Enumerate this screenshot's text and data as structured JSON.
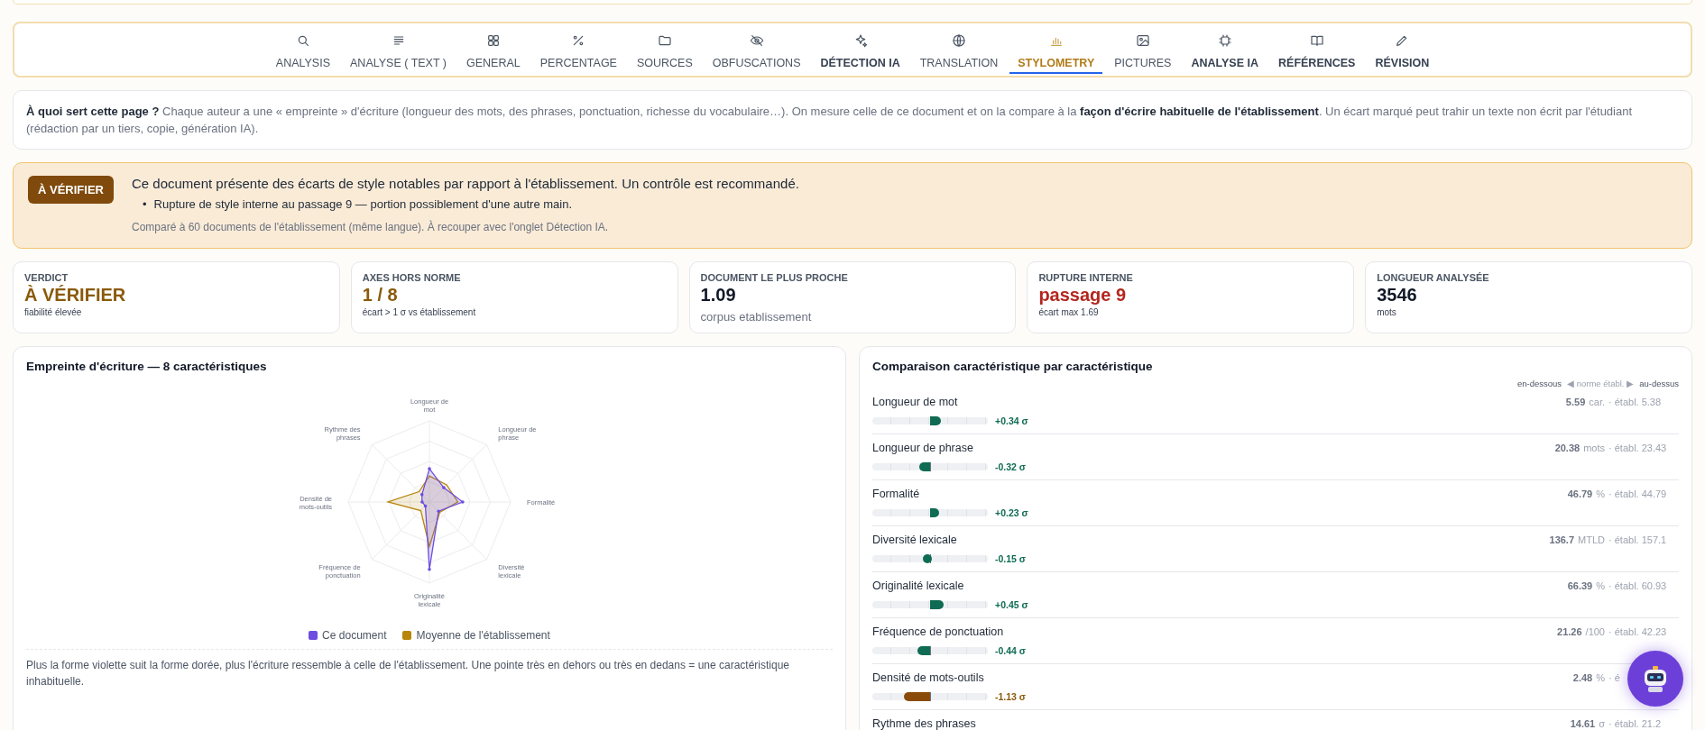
{
  "tabs": [
    {
      "label": "ANALYSIS",
      "selected": false,
      "emphasized": false
    },
    {
      "label": "ANALYSE ( TEXT )",
      "selected": false,
      "emphasized": false
    },
    {
      "label": "GENERAL",
      "selected": false,
      "emphasized": false
    },
    {
      "label": "PERCENTAGE",
      "selected": false,
      "emphasized": false
    },
    {
      "label": "SOURCES",
      "selected": false,
      "emphasized": false
    },
    {
      "label": "OBFUSCATIONS",
      "selected": false,
      "emphasized": false
    },
    {
      "label": "DÉTECTION IA",
      "selected": false,
      "emphasized": true
    },
    {
      "label": "TRANSLATION",
      "selected": false,
      "emphasized": false
    },
    {
      "label": "STYLOMETRY",
      "selected": true,
      "emphasized": false
    },
    {
      "label": "PICTURES",
      "selected": false,
      "emphasized": false
    },
    {
      "label": "ANALYSE IA",
      "selected": false,
      "emphasized": true
    },
    {
      "label": "RÉFÉRENCES",
      "selected": false,
      "emphasized": true
    },
    {
      "label": "RÉVISION",
      "selected": false,
      "emphasized": true
    }
  ],
  "info": {
    "text": "**À quoi sert cette page ?** Chaque auteur a une « empreinte » d'écriture (longueur des mots, des phrases, ponctuation, richesse du vocabulaire…). On mesure celle de ce document et on la compare à la **façon d'écrire habituelle de l'établissement**. Un écart marqué peut trahir un texte non écrit par l'étudiant (rédaction par un tiers, copie, génération IA)."
  },
  "alert": {
    "badge": "À VÉRIFIER",
    "message": "Ce document présente des écarts de style notables par rapport à l'établissement. Un contrôle est recommandé.",
    "bullet_mark": "•",
    "bullets": [
      "Rupture de style interne au passage 9 — portion possiblement d'une autre main."
    ],
    "note": "Comparé à 60 documents de l'établissement (même langue). À recouper avec l'onglet Détection IA."
  },
  "stats": [
    {
      "label": "VERDICT",
      "value": "À VÉRIFIER",
      "kind": "warning",
      "sub": "fiabilité élevée",
      "sub_large": false
    },
    {
      "label": "AXES HORS NORME",
      "value": "1 / 8",
      "kind": "warning",
      "sub": "écart > 1 σ vs établissement",
      "sub_large": false
    },
    {
      "label": "DOCUMENT LE PLUS PROCHE",
      "value": "1.09",
      "kind": "neutral",
      "sub": "corpus etablissement",
      "sub_large": true
    },
    {
      "label": "RUPTURE INTERNE",
      "value": "passage 9",
      "kind": "danger",
      "sub": "écart max 1.69",
      "sub_large": false
    },
    {
      "label": "LONGUEUR ANALYSÉE",
      "value": "3546",
      "kind": "neutral",
      "sub": "mots",
      "sub_large": false
    }
  ],
  "fingerprint": {
    "title": "Empreinte d'écriture — 8 caractéristiques",
    "axes": [
      "Longueur de mot",
      "Longueur de phrase",
      "Formalité",
      "Diversité lexicale",
      "Originalité lexicale",
      "Fréquence de ponctuation",
      "Densité de mots-outils",
      "Rythme des phrases"
    ],
    "legend": [
      {
        "label": "Ce document",
        "color": "#6d4ee0"
      },
      {
        "label": "Moyenne de l'établissement",
        "color": "#b8860b"
      }
    ],
    "footnote": "Plus la forme violette suit la forme dorée, plus l'écriture ressemble à celle de l'établissement. Une pointe très en dehors ou très en dedans = une caractéristique inhabituelle."
  },
  "comparison": {
    "title": "Comparaison caractéristique par caractéristique",
    "scale": {
      "below": "en-dessous",
      "middle": "◀ norme établ. ▶",
      "above": "au-dessus"
    },
    "rows": [
      {
        "name": "Longueur de mot",
        "level": 0.557,
        "sigma": "+0.34 σ",
        "outlier": false,
        "value": "5.59",
        "unit": "car.",
        "ref": "· établ. 5.38"
      },
      {
        "name": "Longueur de phrase",
        "level": 0.447,
        "sigma": "-0.32 σ",
        "outlier": false,
        "value": "20.38",
        "unit": "mots",
        "ref": "· établ. 23.43"
      },
      {
        "name": "Formalité",
        "level": 0.538,
        "sigma": "+0.23 σ",
        "outlier": false,
        "value": "46.79",
        "unit": "%",
        "ref": "· établ. 44.79"
      },
      {
        "name": "Diversité lexicale",
        "level": 0.475,
        "sigma": "-0.15 σ",
        "outlier": false,
        "value": "136.7",
        "unit": "MTLD",
        "ref": "· établ. 157.1"
      },
      {
        "name": "Originalité lexicale",
        "level": 0.575,
        "sigma": "+0.45 σ",
        "outlier": false,
        "value": "66.39",
        "unit": "%",
        "ref": "· établ. 60.93"
      },
      {
        "name": "Fréquence de ponctuation",
        "level": 0.427,
        "sigma": "-0.44 σ",
        "outlier": false,
        "value": "21.26",
        "unit": "/100",
        "ref": "· établ. 42.23"
      },
      {
        "name": "Densité de mots-outils",
        "level": 0.312,
        "sigma": "-1.13 σ",
        "outlier": true,
        "value": "2.48",
        "unit": "%",
        "ref": "· é"
      },
      {
        "name": "Rythme des phrases",
        "value": "14.61",
        "unit": "σ",
        "ref": "· établ. 21.2"
      }
    ]
  }
}
